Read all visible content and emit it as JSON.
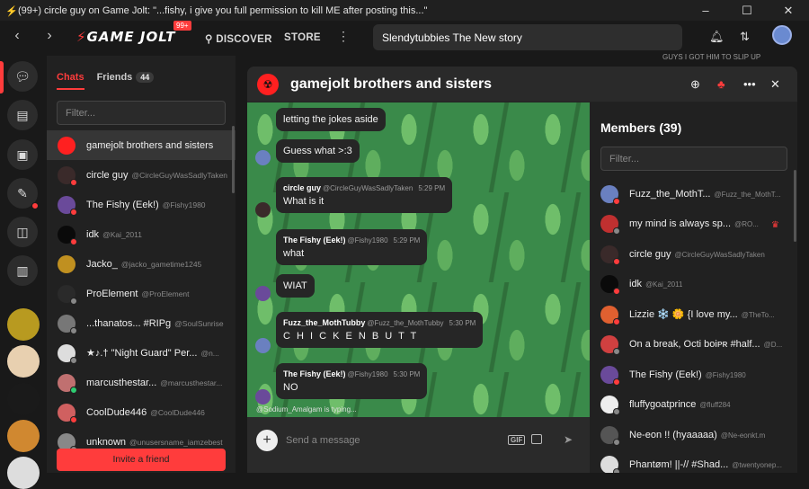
{
  "window": {
    "title": "(99+) circle guy on Game Jolt: \"...fishy, i give you full permission to kill ME after posting this...\"",
    "controls": [
      "–",
      "☐",
      "✕"
    ]
  },
  "topnav": {
    "logo_text": "GAME JOLT",
    "logo_badge": "99+",
    "discover": "DISCOVER",
    "store": "STORE",
    "search_value": "Slendytubbies The New story"
  },
  "ticker": "GUYS I GOT HIM TO SLIP UP",
  "chats_panel": {
    "tab_chats": "Chats",
    "tab_friends": "Friends",
    "friends_count": "44",
    "filter_placeholder": "Filter...",
    "items": [
      {
        "name": "gamejolt brothers and sisters",
        "user": "",
        "color": "#ff2020",
        "status": ""
      },
      {
        "name": "circle guy",
        "user": "@CircleGuyWasSadlyTaken",
        "color": "#3a2a2a",
        "status": "#ff3c3c"
      },
      {
        "name": "The Fishy (Eek!)",
        "user": "@Fishy1980",
        "color": "#6a4a9a",
        "status": "#ff3c3c"
      },
      {
        "name": "idk",
        "user": "@Kai_2011",
        "color": "#0a0a0a",
        "status": "#ff3c3c"
      },
      {
        "name": "Jacko_",
        "user": "@jacko_gametime1245",
        "color": "#c09020",
        "status": ""
      },
      {
        "name": "ProElement",
        "user": "@ProElement",
        "color": "#2a2a2a",
        "status": "#888"
      },
      {
        "name": "...thanatos... #RIPg",
        "user": "@SoulSunrise",
        "color": "#777",
        "status": "#888"
      },
      {
        "name": "★♪.† \"Night Guard\" Per...",
        "user": "@n...",
        "color": "#ddd",
        "status": "#888"
      },
      {
        "name": "marcusthestar...",
        "user": "@marcusthestar...",
        "color": "#c07070",
        "status": "#2ecc71"
      },
      {
        "name": "CoolDude446",
        "user": "@CoolDude446",
        "color": "#d06060",
        "status": "#ff3c3c"
      },
      {
        "name": "unknown",
        "user": "@unusersname_iamzebest",
        "color": "#888",
        "status": "#888"
      }
    ],
    "invite_label": "Invite a friend"
  },
  "main": {
    "group_title": "gamejolt brothers and sisters",
    "messages": [
      {
        "author": "",
        "user": "",
        "time": "",
        "text": "letting the jokes aside",
        "avatar_color": ""
      },
      {
        "author": "",
        "user": "",
        "time": "",
        "text": "Guess what >:3",
        "avatar_color": "#6a80c0"
      },
      {
        "author": "circle guy",
        "user": "@CircleGuyWasSadlyTaken",
        "time": "5:29 PM",
        "text": "What is it",
        "avatar_color": "#3a2a2a"
      },
      {
        "author": "The Fishy (Eek!)",
        "user": "@Fishy1980",
        "time": "5:29 PM",
        "text": "what",
        "avatar_color": ""
      },
      {
        "author": "",
        "user": "",
        "time": "",
        "text": "WIAT",
        "avatar_color": "#6a4a9a"
      },
      {
        "author": "Fuzz_the_MothTubby",
        "user": "@Fuzz_the_MothTubby",
        "time": "5:30 PM",
        "text": "C H I C K E N   B U T T",
        "avatar_color": "#6a80c0"
      },
      {
        "author": "The Fishy (Eek!)",
        "user": "@Fishy1980",
        "time": "5:30 PM",
        "text": "NO",
        "avatar_color": "#6a4a9a"
      }
    ],
    "typing": "@Sodium_Amalgam is typing...",
    "composer_placeholder": "Send a message",
    "gif_label": "GIF"
  },
  "members": {
    "title": "Members (39)",
    "filter_placeholder": "Filter...",
    "items": [
      {
        "name": "Fuzz_the_MothT...",
        "user": "@Fuzz_the_MothT...",
        "color": "#6a80c0",
        "status": "#ff3c3c",
        "crown": false
      },
      {
        "name": "my mind is always sp...",
        "user": "@RO...",
        "color": "#c03030",
        "status": "#888",
        "crown": true
      },
      {
        "name": "circle guy",
        "user": "@CircleGuyWasSadlyTaken",
        "color": "#3a2a2a",
        "status": "#ff3c3c",
        "crown": false
      },
      {
        "name": "idk",
        "user": "@Kai_2011",
        "color": "#0a0a0a",
        "status": "#ff3c3c",
        "crown": false
      },
      {
        "name": "Lizzie ❄️ 🌼 {I love my...",
        "user": "@TheTo...",
        "color": "#e06030",
        "status": "#ff3c3c",
        "crown": false
      },
      {
        "name": "On a break, Octi boiᴘʀ #half...",
        "user": "@D...",
        "color": "#d04040",
        "status": "#888",
        "crown": false
      },
      {
        "name": "The Fishy (Eek!)",
        "user": "@Fishy1980",
        "color": "#6a4a9a",
        "status": "#ff3c3c",
        "crown": false
      },
      {
        "name": "fluffygoatprince",
        "user": "@fluff284",
        "color": "#eee",
        "status": "#888",
        "crown": false
      },
      {
        "name": "Ne-eon !! (hyaaaaa)",
        "user": "@Ne-eonkt.m",
        "color": "#555",
        "status": "#888",
        "crown": false
      },
      {
        "name": "Phantøm! ||-// #Shad...",
        "user": "@twentyonep...",
        "color": "#ddd",
        "status": "#888",
        "crown": false
      }
    ]
  },
  "colors": {
    "accent": "#ff3c3c",
    "online": "#2ecc71"
  }
}
